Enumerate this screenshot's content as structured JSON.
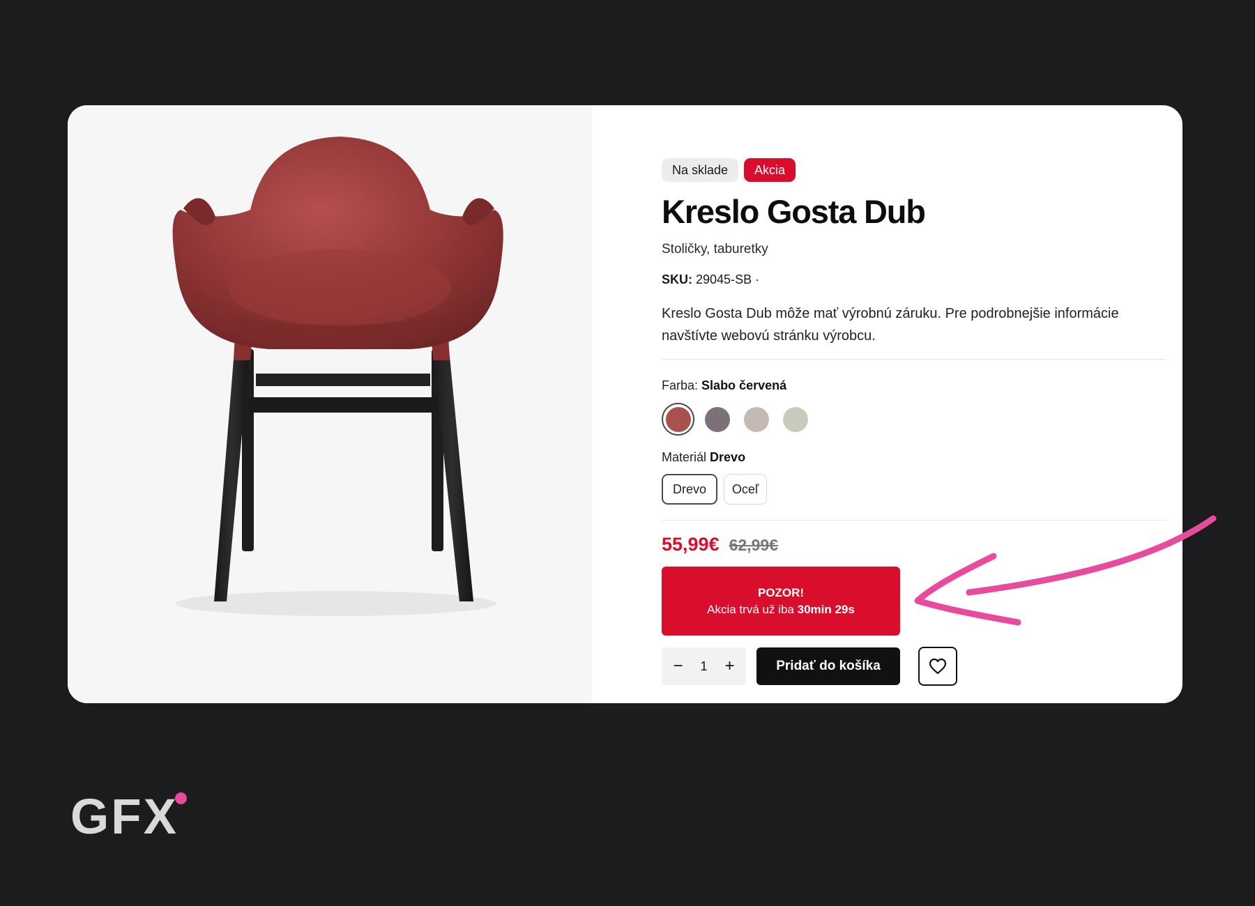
{
  "product": {
    "badges": {
      "stock": "Na sklade",
      "sale": "Akcia"
    },
    "title": "Kreslo Gosta Dub",
    "category": "Stoličky, taburetky",
    "sku_label": "SKU:",
    "sku_value": "29045-SB ·",
    "description": "Kreslo Gosta Dub môže mať výrobnú záruku. Pre podrobnejšie informácie navštívte webovú stránku výrobcu.",
    "color": {
      "label": "Farba:",
      "selected": "Slabo červená",
      "swatches": [
        "#a9514f",
        "#7c7179",
        "#c5bab3",
        "#c8cbbb"
      ]
    },
    "material": {
      "label": "Materiál",
      "selected": "Drevo",
      "options": [
        "Drevo",
        "Oceľ"
      ]
    },
    "price": {
      "current": "55,99€",
      "original": "62,99€"
    },
    "promo": {
      "title": "POZOR!",
      "text": "Akcia trvá už iba",
      "countdown": "30min 29s"
    },
    "quantity": {
      "minus": "−",
      "value": "1",
      "plus": "+"
    },
    "add_to_cart": "Pridať do košíka",
    "wishlist_icon": "heart-icon"
  },
  "colors": {
    "accent_red": "#d90d2c",
    "arrow_pink": "#e84a9c",
    "background": "#1c1b1d"
  },
  "brand": {
    "logo_text": "GFX"
  }
}
